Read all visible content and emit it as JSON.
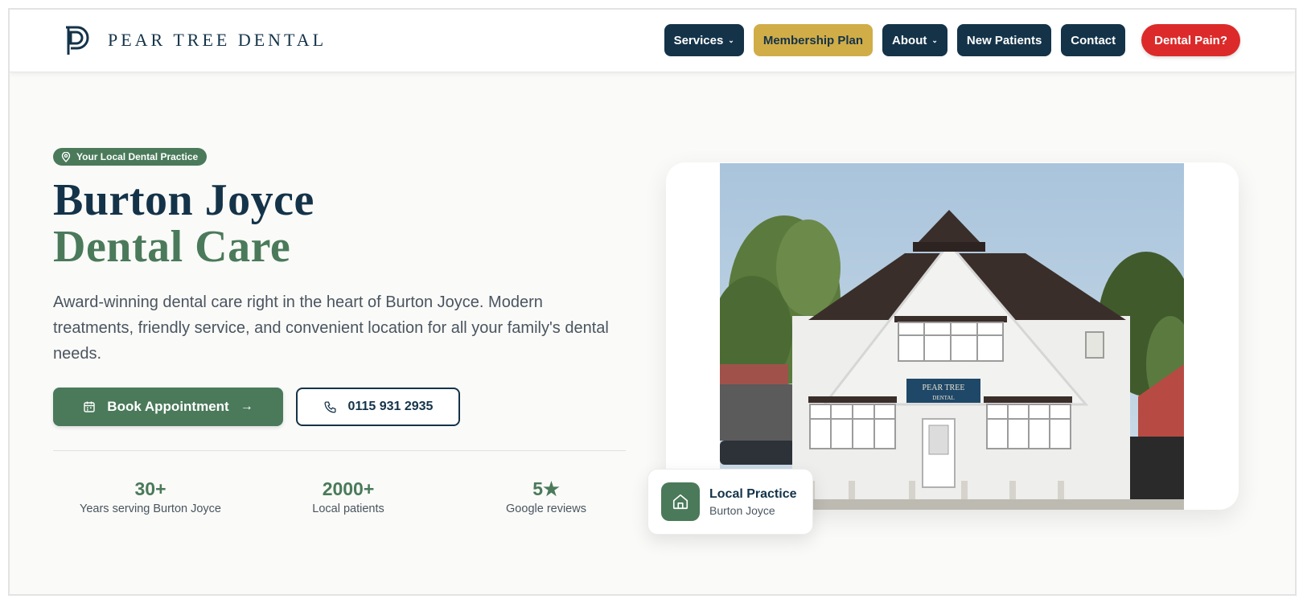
{
  "brand": {
    "name": "PEAR TREE DENTAL",
    "logo_icon": "pd-monogram-icon"
  },
  "nav": {
    "services": "Services",
    "membership": "Membership Plan",
    "about": "About",
    "new_patients": "New Patients",
    "contact": "Contact",
    "dental_pain": "Dental Pain?"
  },
  "hero": {
    "badge": "Your Local Dental Practice",
    "title_line1": "Burton Joyce",
    "title_line2": "Dental Care",
    "description": "Award-winning dental care right in the heart of Burton Joyce. Modern treatments, friendly service, and convenient location for all your family's dental needs.",
    "book_label": "Book Appointment",
    "phone_label": "0115 931 2935"
  },
  "stats": [
    {
      "value": "30+",
      "label": "Years serving Burton Joyce"
    },
    {
      "value": "2000+",
      "label": "Local patients"
    },
    {
      "value": "5★",
      "label": "Google reviews"
    }
  ],
  "photo": {
    "sign_line1": "PEAR TREE",
    "sign_line2": "DENTAL"
  },
  "location_card": {
    "title": "Local Practice",
    "subtitle": "Burton Joyce"
  },
  "colors": {
    "navy": "#143349",
    "green": "#4a7a5a",
    "gold": "#d1ad48",
    "red": "#dc2a2a",
    "background": "#fafaf8"
  }
}
